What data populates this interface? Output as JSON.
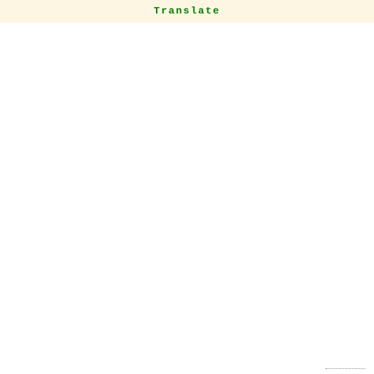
{
  "header": {
    "title": "Translate"
  }
}
